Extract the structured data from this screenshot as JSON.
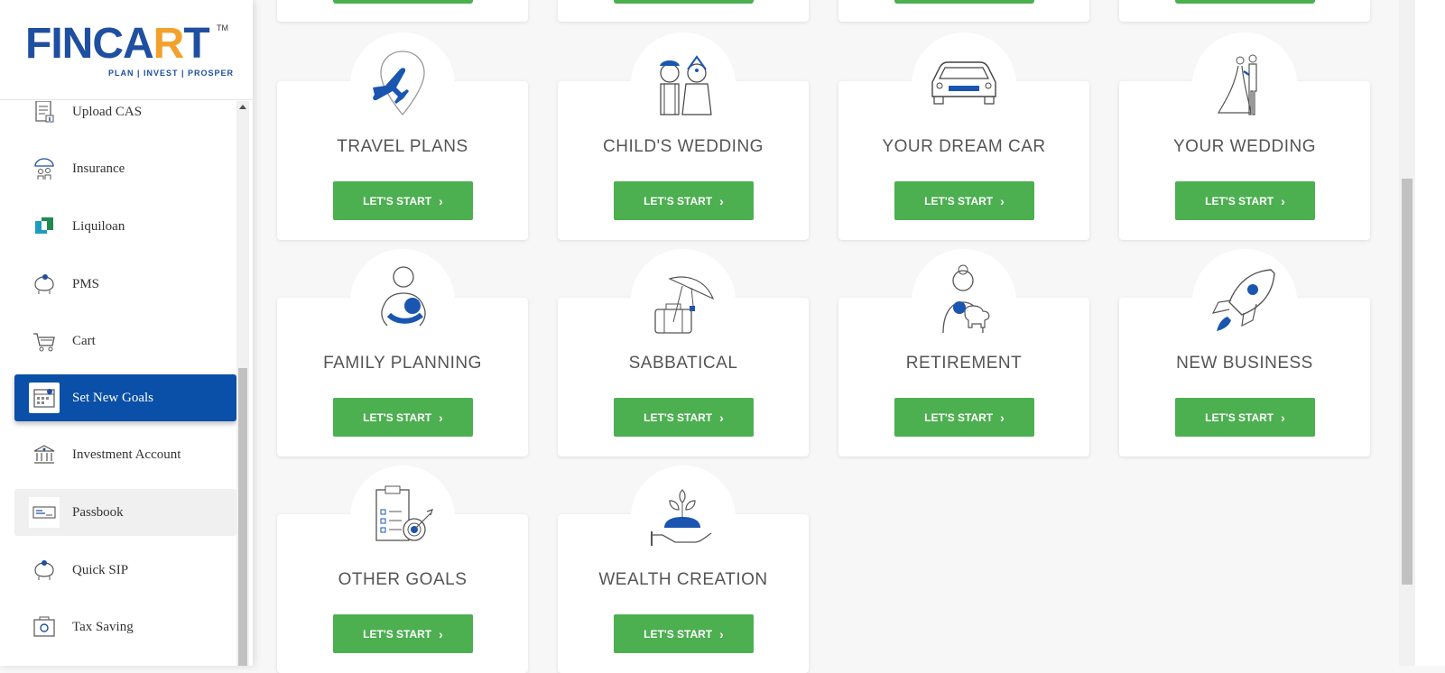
{
  "brand": {
    "name_part1": "FINCA",
    "name_accent": "R",
    "name_part2": "T",
    "tm": "TM",
    "tagline": "PLAN | INVEST | PROSPER"
  },
  "sidebar": {
    "items": [
      {
        "label": "Upload CAS",
        "icon": "upload-cas-icon"
      },
      {
        "label": "Insurance",
        "icon": "insurance-icon"
      },
      {
        "label": "Liquiloan",
        "icon": "liquiloan-icon"
      },
      {
        "label": "PMS",
        "icon": "pms-icon"
      },
      {
        "label": "Cart",
        "icon": "cart-icon"
      },
      {
        "label": "Set New Goals",
        "icon": "goals-icon",
        "active": true
      },
      {
        "label": "Investment Account",
        "icon": "bank-icon"
      },
      {
        "label": "Passbook",
        "icon": "passbook-icon"
      },
      {
        "label": "Quick SIP",
        "icon": "quick-sip-icon"
      },
      {
        "label": "Tax Saving",
        "icon": "tax-saving-icon"
      }
    ]
  },
  "goals": {
    "button_label": "LET'S START",
    "chevron": "›",
    "cards": [
      {
        "title": "TRAVEL PLANS",
        "icon": "travel-icon"
      },
      {
        "title": "CHILD'S WEDDING",
        "icon": "childs-wedding-icon"
      },
      {
        "title": "YOUR DREAM CAR",
        "icon": "car-icon"
      },
      {
        "title": "YOUR WEDDING",
        "icon": "wedding-icon"
      },
      {
        "title": "FAMILY PLANNING",
        "icon": "family-icon"
      },
      {
        "title": "SABBATICAL",
        "icon": "sabbatical-icon"
      },
      {
        "title": "RETIREMENT",
        "icon": "retirement-icon"
      },
      {
        "title": "NEW BUSINESS",
        "icon": "rocket-icon"
      },
      {
        "title": "OTHER GOALS",
        "icon": "checklist-target-icon"
      },
      {
        "title": "WEALTH CREATION",
        "icon": "wealth-plant-icon"
      }
    ]
  },
  "colors": {
    "primary_blue": "#0a4fa8",
    "button_green": "#4caf50",
    "accent_orange": "#f2a22c"
  }
}
